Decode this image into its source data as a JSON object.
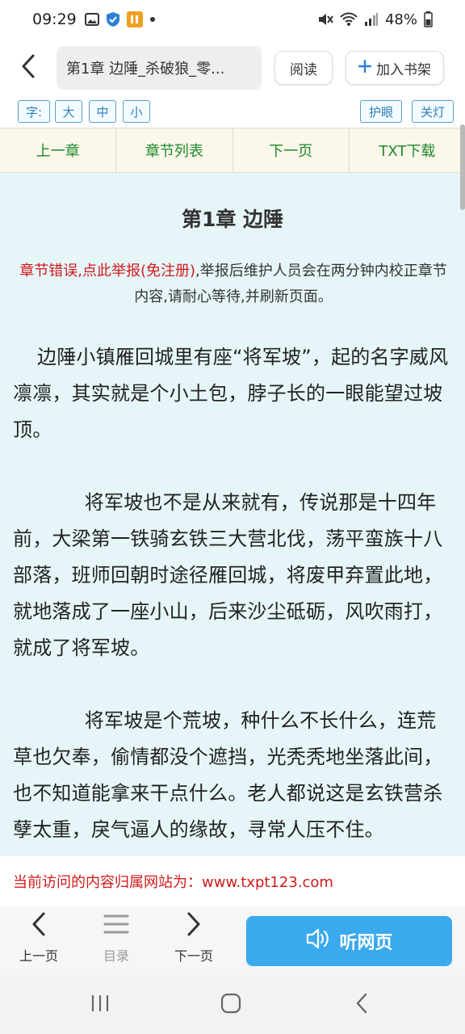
{
  "status": {
    "time": "09:29",
    "battery": "48%"
  },
  "browser": {
    "url_title": "第1章 边陲_杀破狼_零...",
    "read_label": "阅读",
    "add_shelf_label": "加入书架"
  },
  "font_tools": {
    "font_label": "字:",
    "large": "大",
    "medium": "中",
    "small": "小",
    "eye_care": "护眼",
    "light_off": "关灯"
  },
  "chapter_nav": [
    "上一章",
    "章节列表",
    "下一页",
    "TXT下载"
  ],
  "chapter": {
    "title": "第1章 边陲",
    "report_link": "章节错误,点此举报(免注册)",
    "report_text": ",举报后维护人员会在两分钟内校正章节内容,请耐心等待,并刷新页面。",
    "paragraphs": [
      "边陲小镇雁回城里有座“将军坡”，起的名字威风凛凛，其实就是个小土包，脖子长的一眼能望过坡顶。",
      "将军坡也不是从来就有，传说那是十四年前，大梁第一铁骑玄铁三大营北伐，荡平蛮族十八部落，班师回朝时途径雁回城，将废甲弃置此地，就地落成了一座小山，后来沙尘砥砺，风吹雨打，就成了将军坡。",
      "将军坡是个荒坡，种什么不长什么，连荒草也欠奉，偷情都没个遮挡，光秃秃地坐落此间，也不知道能拿来干点什么。老人都说这是玄铁营杀孽太重，戾气逼人的缘故，寻常人压不住。"
    ]
  },
  "source": {
    "text": "当前访问的内容归属网站为：www.txpt123.com"
  },
  "bottom_bar": {
    "prev_page": "上一页",
    "catalog": "目录",
    "next_page": "下一页",
    "listen": "听网页"
  },
  "colors": {
    "reader_bg": "#e6f5f8",
    "nav_green": "#1f8a2e",
    "alert_red": "#d11a1a",
    "listen_blue": "#3aa9ee"
  }
}
